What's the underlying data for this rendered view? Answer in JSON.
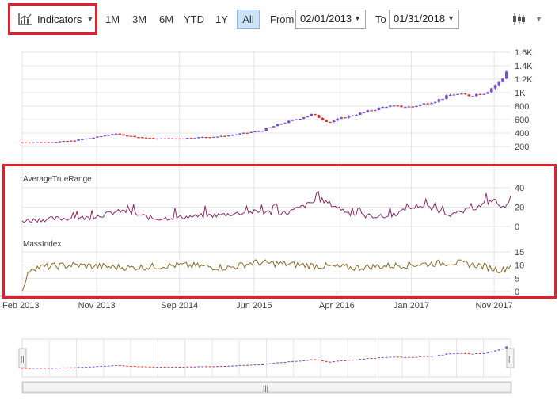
{
  "toolbar": {
    "indicators_label": "Indicators",
    "indicators_icon": "line-chart-icon",
    "ranges": [
      "1M",
      "3M",
      "6M",
      "YTD",
      "1Y",
      "All"
    ],
    "active_range": "All",
    "from_label": "From",
    "from_value": "02/01/2013",
    "to_label": "To",
    "to_value": "01/31/2018",
    "chart_type_icon": "candlestick-icon"
  },
  "colors": {
    "highlight": "#e0202a",
    "candle_up": "#7e50c8",
    "candle_down": "#e0302a",
    "atr_line": "#8a2a6a",
    "mass_line": "#8a6a2a",
    "grid": "#e4e4e4",
    "axis_text": "#444444"
  },
  "chart_data": [
    {
      "type": "candlestick",
      "ylim": [
        200,
        1600
      ],
      "y_ticks": [
        "200",
        "400",
        "600",
        "800",
        "1K",
        "1.2K",
        "1.4K",
        "1.6K"
      ],
      "y_tick_values": [
        200,
        400,
        600,
        800,
        1000,
        1200,
        1400,
        1600
      ],
      "grid": true,
      "close_series": [
        [
          "2013-02",
          262
        ],
        [
          "2013-05",
          263
        ],
        [
          "2013-08",
          285
        ],
        [
          "2013-11",
          340
        ],
        [
          "2014-01",
          390
        ],
        [
          "2014-04",
          340
        ],
        [
          "2014-06",
          315
        ],
        [
          "2014-09",
          320
        ],
        [
          "2014-12",
          340
        ],
        [
          "2015-02",
          350
        ],
        [
          "2015-05",
          400
        ],
        [
          "2015-07",
          440
        ],
        [
          "2015-09",
          530
        ],
        [
          "2015-11",
          600
        ],
        [
          "2016-01",
          680
        ],
        [
          "2016-03",
          560
        ],
        [
          "2016-05",
          640
        ],
        [
          "2016-07",
          700
        ],
        [
          "2016-10",
          800
        ],
        [
          "2017-01",
          790
        ],
        [
          "2017-04",
          880
        ],
        [
          "2017-06",
          980
        ],
        [
          "2017-08",
          960
        ],
        [
          "2017-10",
          1000
        ],
        [
          "2017-12",
          1200
        ],
        [
          "2018-01",
          1450
        ]
      ]
    },
    {
      "type": "line",
      "title": "AverageTrueRange",
      "ylim": [
        0,
        40
      ],
      "y_ticks": [
        "0",
        "20",
        "40"
      ],
      "y_tick_values": [
        0,
        20,
        40
      ],
      "grid": true,
      "series": [
        {
          "name": "AverageTrueRange",
          "values": [
            [
              "2013-02",
              6
            ],
            [
              "2013-06",
              8
            ],
            [
              "2013-10",
              9
            ],
            [
              "2014-02",
              16
            ],
            [
              "2014-06",
              8
            ],
            [
              "2014-10",
              10
            ],
            [
              "2015-02",
              12
            ],
            [
              "2015-06",
              15
            ],
            [
              "2015-10",
              14
            ],
            [
              "2016-02",
              28
            ],
            [
              "2016-06",
              12
            ],
            [
              "2016-10",
              10
            ],
            [
              "2017-02",
              22
            ],
            [
              "2017-06",
              12
            ],
            [
              "2017-09",
              20
            ],
            [
              "2017-11",
              28
            ],
            [
              "2017-12",
              18
            ],
            [
              "2018-01",
              30
            ]
          ]
        }
      ]
    },
    {
      "type": "line",
      "title": "MassIndex",
      "ylim": [
        0,
        15
      ],
      "y_ticks": [
        "0",
        "5",
        "10",
        "15"
      ],
      "y_tick_values": [
        0,
        5,
        10,
        15
      ],
      "grid": true,
      "series": [
        {
          "name": "MassIndex",
          "values": [
            [
              "2013-02",
              0
            ],
            [
              "2013-03",
              9
            ],
            [
              "2013-08",
              10
            ],
            [
              "2014-03",
              9
            ],
            [
              "2014-09",
              10
            ],
            [
              "2015-03",
              9
            ],
            [
              "2015-06",
              11
            ],
            [
              "2015-12",
              10
            ],
            [
              "2016-06",
              9
            ],
            [
              "2016-12",
              10
            ],
            [
              "2017-06",
              11
            ],
            [
              "2017-09",
              10
            ],
            [
              "2017-12",
              8
            ],
            [
              "2018-01",
              10
            ]
          ]
        }
      ]
    }
  ],
  "x_axis": {
    "ticks": [
      {
        "label": "Feb 2013",
        "value": "2013-02"
      },
      {
        "label": "Nov 2013",
        "value": "2013-11"
      },
      {
        "label": "Sep 2014",
        "value": "2014-09"
      },
      {
        "label": "Jun 2015",
        "value": "2015-06"
      },
      {
        "label": "Apr 2016",
        "value": "2016-04"
      },
      {
        "label": "Jan 2017",
        "value": "2017-01"
      },
      {
        "label": "Nov 2017",
        "value": "2017-11"
      }
    ]
  },
  "navigator": {
    "left_handle": "||",
    "right_handle": "||",
    "scroll_thumb": "|||"
  }
}
